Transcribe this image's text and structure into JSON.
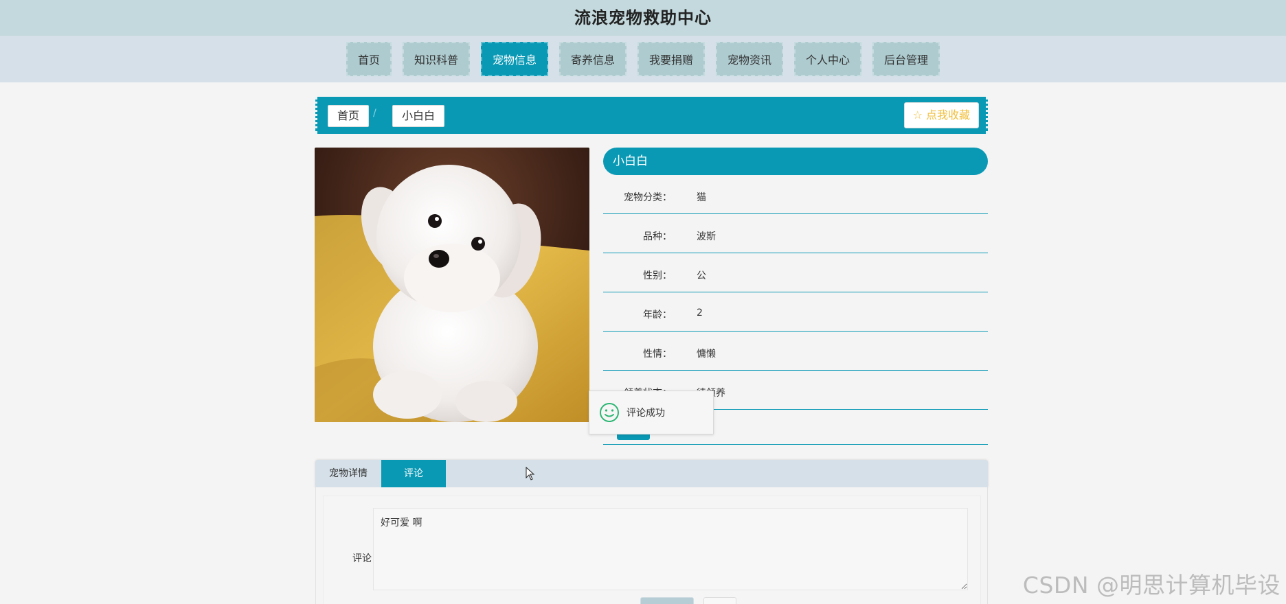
{
  "header": {
    "title": "流浪宠物救助中心"
  },
  "nav": {
    "items": [
      {
        "label": "首页"
      },
      {
        "label": "知识科普"
      },
      {
        "label": "宠物信息"
      },
      {
        "label": "寄养信息"
      },
      {
        "label": "我要捐赠"
      },
      {
        "label": "宠物资讯"
      },
      {
        "label": "个人中心"
      },
      {
        "label": "后台管理"
      }
    ],
    "active_index": 2
  },
  "breadcrumb": {
    "home": "首页",
    "separator": "/",
    "current": "小白白",
    "collect_label": "☆ 点我收藏"
  },
  "pet": {
    "name": "小白白",
    "fields": [
      {
        "label": "宠物分类：",
        "value": "猫"
      },
      {
        "label": "品种：",
        "value": "波斯"
      },
      {
        "label": "性别：",
        "value": "公"
      },
      {
        "label": "年龄：",
        "value": "2"
      },
      {
        "label": "性情：",
        "value": "慵懒"
      },
      {
        "label": "领养状态：",
        "value": "待领养"
      }
    ]
  },
  "toast": {
    "text": "评论成功"
  },
  "tabs": [
    {
      "label": "宠物详情"
    },
    {
      "label": "评论"
    }
  ],
  "comment": {
    "label": "评论",
    "value": "好可爱 啊"
  },
  "watermark": "CSDN @明思计算机毕设",
  "colors": {
    "primary": "#0a99b5",
    "header_bg": "#c3d9dd",
    "nav_bg": "#d5e0e8",
    "nav_item_bg": "#aecbcf",
    "collect_text": "#f0c040",
    "toast_icon": "#2bb673"
  }
}
